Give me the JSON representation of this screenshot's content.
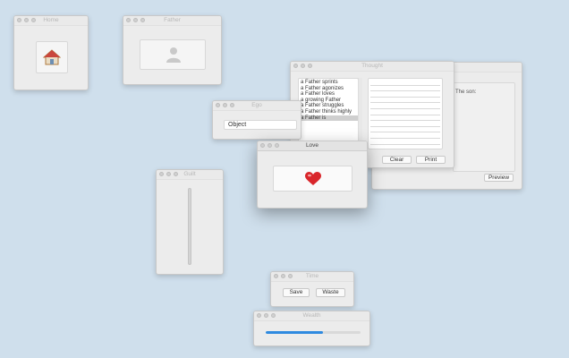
{
  "windows": {
    "home": {
      "title": "Home",
      "icon": "house-icon"
    },
    "father": {
      "title": "Father",
      "icon": "person-icon"
    },
    "thought": {
      "title": "Thought",
      "list_items": [
        "a Father sprints",
        "a Father agonizes",
        "a Father loves",
        "a growing Father",
        "a Father struggles",
        "a Father thinks highly",
        "a Father is"
      ],
      "selected_index": 6,
      "clear_label": "Clear",
      "print_label": "Print"
    },
    "preview": {
      "label": "The son:",
      "preview_label": "Preview"
    },
    "ego": {
      "title": "Ego",
      "field_value": "Object"
    },
    "love": {
      "title": "Love",
      "icon": "heart-icon"
    },
    "guilt": {
      "title": "Guilt",
      "slider_value": 1.0
    },
    "time": {
      "title": "Time",
      "save_label": "Save",
      "waste_label": "Waste"
    },
    "wealth": {
      "title": "Wealth",
      "progress": 0.6
    }
  },
  "colors": {
    "desktop": "#cfdfec",
    "progress_fill": "#2f8ae0",
    "heart": "#d9262b"
  }
}
